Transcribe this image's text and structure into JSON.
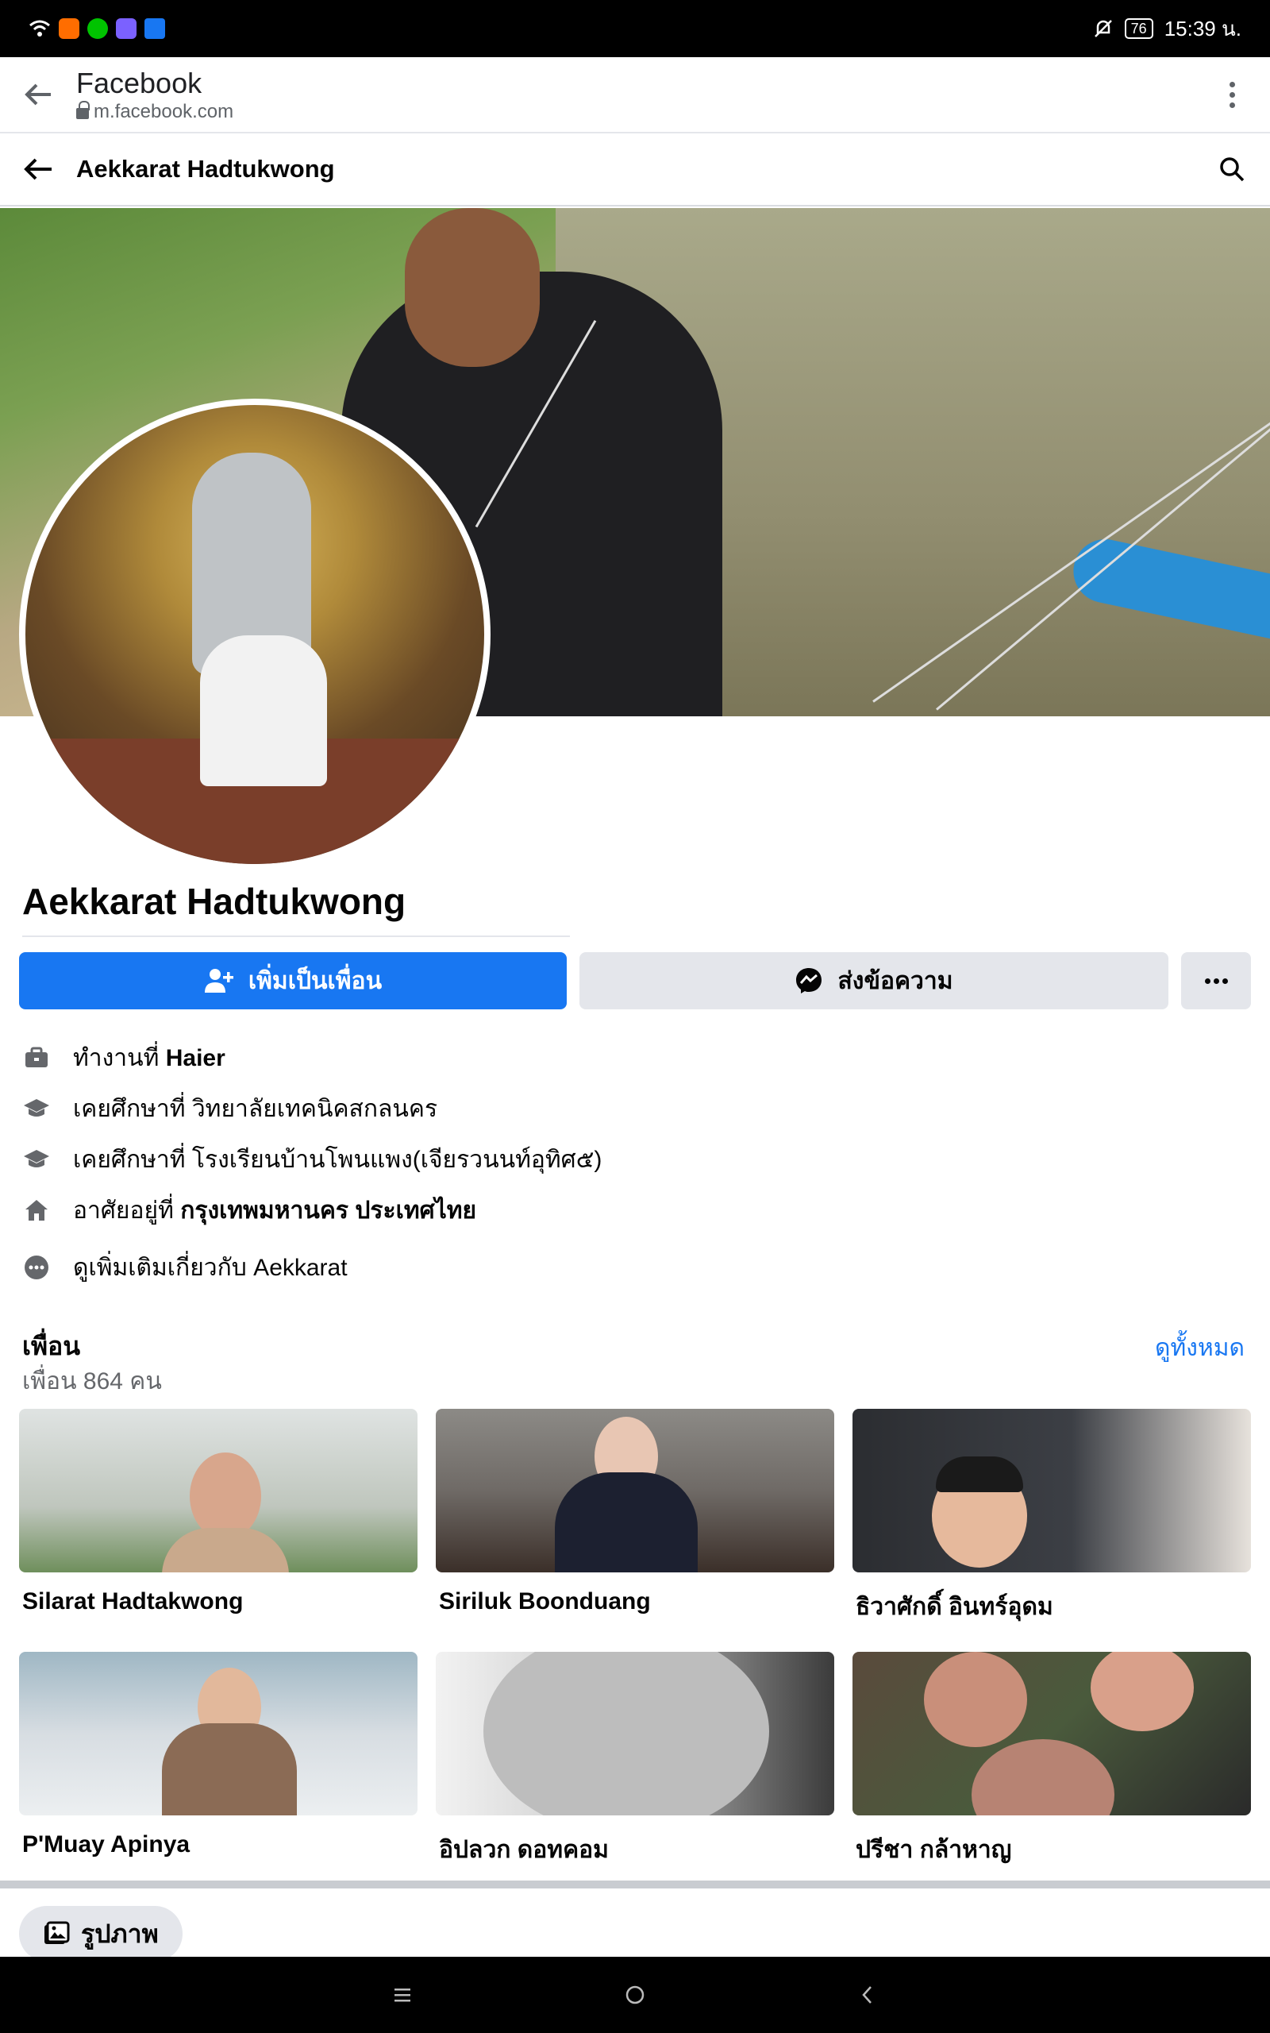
{
  "status_bar": {
    "time": "15:39 น.",
    "battery": "76",
    "icons": [
      "wifi-icon",
      "app-icon",
      "line-icon",
      "messenger-icon",
      "facebook-icon",
      "mute-icon"
    ]
  },
  "browser": {
    "title": "Facebook",
    "url": "m.facebook.com"
  },
  "header": {
    "title": "Aekkarat Hadtukwong"
  },
  "profile": {
    "name": "Aekkarat Hadtukwong",
    "add_friend_label": "เพิ่มเป็นเพื่อน",
    "message_label": "ส่งข้อความ"
  },
  "intro": [
    {
      "icon": "briefcase-icon",
      "prefix": "ทำงานที่ ",
      "bold": "Haier"
    },
    {
      "icon": "graduation-cap-icon",
      "prefix": "เคยศึกษาที่ วิทยาลัยเทคนิคสกลนคร",
      "bold": ""
    },
    {
      "icon": "graduation-cap-icon",
      "prefix": "เคยศึกษาที่ โรงเรียนบ้านโพนแพง(เจียรวนนท์อุทิศ๕)",
      "bold": ""
    },
    {
      "icon": "home-icon",
      "prefix": "อาศัยอยู่ที่ ",
      "bold": "กรุงเทพมหานคร ประเทศไทย"
    },
    {
      "icon": "more-icon",
      "prefix": "ดูเพิ่มเติมเกี่ยวกับ Aekkarat",
      "bold": ""
    }
  ],
  "friends": {
    "title": "เพื่อน",
    "count": "เพื่อน 864 คน",
    "see_all": "ดูทั้งหมด",
    "items": [
      {
        "name": "Silarat Hadtakwong",
        "bg": "#bfc6bd",
        "accent": "#c9a98c"
      },
      {
        "name": "Siriluk Boonduang",
        "bg": "#6f6a66",
        "accent": "#1c2030"
      },
      {
        "name": "ธิวาศักดิ์ อินทร์อุดม",
        "bg": "#2b2d31",
        "accent": "#e7e2dc"
      },
      {
        "name": "P'Muay Apinya",
        "bg": "#d7dde2",
        "accent": "#8b6b55"
      },
      {
        "name": "อิปลวก ดอทคอม",
        "bg": "#cfcfcf",
        "accent": "#3b3b3b"
      },
      {
        "name": "ปรีชา กล้าหาญ",
        "bg": "#5a4a3c",
        "accent": "#c98f7a"
      }
    ]
  },
  "photos": {
    "label": "รูปภาพ"
  },
  "colors": {
    "primary": "#1877f2",
    "secondary_button": "#e4e6eb",
    "muted_text": "#65676b"
  }
}
